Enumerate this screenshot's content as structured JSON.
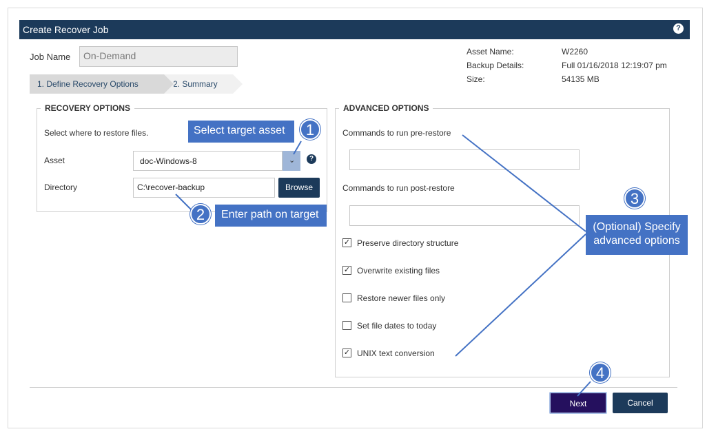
{
  "dialog": {
    "title": "Create Recover Job",
    "help_glyph": "?"
  },
  "job": {
    "name_label": "Job Name",
    "name_value": "On-Demand"
  },
  "steps": [
    {
      "label": "1. Define Recovery Options"
    },
    {
      "label": "2. Summary"
    }
  ],
  "asset_info": {
    "asset_name_label": "Asset Name:",
    "asset_name_value": "W2260",
    "backup_details_label": "Backup Details:",
    "backup_details_value": "Full 01/16/2018 12:19:07 pm",
    "size_label": "Size:",
    "size_value": "54135 MB"
  },
  "recovery_options": {
    "legend": "RECOVERY OPTIONS",
    "instruction": "Select where to restore files.",
    "asset_label": "Asset",
    "asset_value": "doc-Windows-8",
    "directory_label": "Directory",
    "directory_value": "C:\\recover-backup",
    "browse_label": "Browse"
  },
  "advanced_options": {
    "legend": "ADVANCED OPTIONS",
    "pre_restore_label": "Commands to run pre-restore",
    "post_restore_label": "Commands to run post-restore",
    "checkboxes": [
      {
        "label": "Preserve directory structure",
        "checked": true
      },
      {
        "label": "Overwrite existing files",
        "checked": true
      },
      {
        "label": "Restore newer files only",
        "checked": false
      },
      {
        "label": "Set file dates to today",
        "checked": false
      },
      {
        "label": "UNIX text conversion",
        "checked": true
      }
    ]
  },
  "footer": {
    "next_label": "Next",
    "cancel_label": "Cancel"
  },
  "annotations": {
    "callout_1": "Select target asset",
    "callout_2": "Enter path on target",
    "callout_3_line1": "(Optional) Specify",
    "callout_3_line2": "advanced options",
    "badge_1": "1",
    "badge_2": "2",
    "badge_3": "3",
    "badge_4": "4"
  },
  "colors": {
    "header_bg": "#1c3a5a",
    "callout_blue": "#4472c4",
    "next_button": "#25105e"
  }
}
